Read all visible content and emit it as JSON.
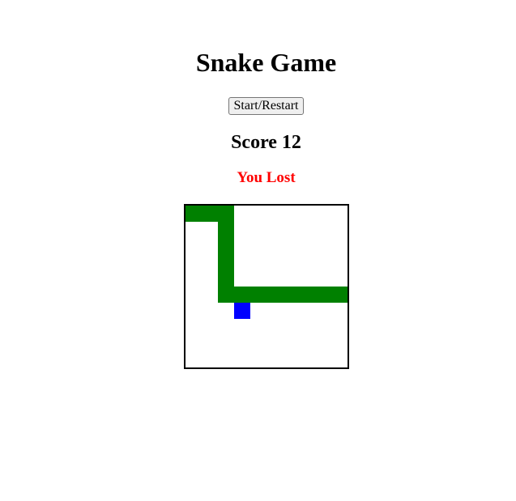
{
  "title": "Snake Game",
  "controls": {
    "start_label": "Start/Restart"
  },
  "score": {
    "text": "Score 12",
    "value": 12
  },
  "status": {
    "text": "You Lost",
    "color": "#ff0000"
  },
  "board": {
    "cols": 10,
    "rows": 10,
    "snake_color": "#008000",
    "food_color": "#0000ff",
    "snake_cells": [
      {
        "col": 0,
        "row": 0
      },
      {
        "col": 1,
        "row": 0
      },
      {
        "col": 2,
        "row": 0
      },
      {
        "col": 2,
        "row": 1
      },
      {
        "col": 2,
        "row": 2
      },
      {
        "col": 2,
        "row": 3
      },
      {
        "col": 2,
        "row": 4
      },
      {
        "col": 2,
        "row": 5
      },
      {
        "col": 3,
        "row": 5
      },
      {
        "col": 4,
        "row": 5
      },
      {
        "col": 5,
        "row": 5
      },
      {
        "col": 6,
        "row": 5
      },
      {
        "col": 7,
        "row": 5
      },
      {
        "col": 8,
        "row": 5
      },
      {
        "col": 9,
        "row": 5
      }
    ],
    "food_cell": {
      "col": 3,
      "row": 6
    }
  }
}
